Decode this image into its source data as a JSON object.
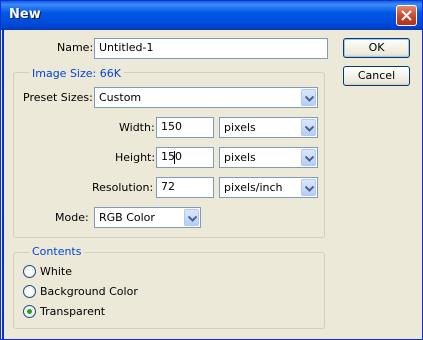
{
  "window": {
    "title": "New"
  },
  "name": {
    "label": "Name:",
    "value": "Untitled-1"
  },
  "image_size": {
    "legend": "Image Size: 66K",
    "preset": {
      "label": "Preset Sizes:",
      "value": "Custom"
    },
    "width": {
      "label": "Width:",
      "value": "150",
      "unit": "pixels"
    },
    "height": {
      "label": "Height:",
      "value": "150",
      "unit": "pixels"
    },
    "resolution": {
      "label": "Resolution:",
      "value": "72",
      "unit": "pixels/inch"
    },
    "mode": {
      "label": "Mode:",
      "value": "RGB Color"
    }
  },
  "contents": {
    "legend": "Contents",
    "options": [
      "White",
      "Background Color",
      "Transparent"
    ],
    "selected": "Transparent"
  },
  "buttons": {
    "ok": "OK",
    "cancel": "Cancel"
  },
  "colors": {
    "titlebar": "#0054e3",
    "accent_text": "#0046d5",
    "dialog_bg": "#ece9d8",
    "radio_dot": "#21a121"
  },
  "icons": {
    "close": "close-x-icon",
    "dropdown": "chevron-down-icon"
  }
}
